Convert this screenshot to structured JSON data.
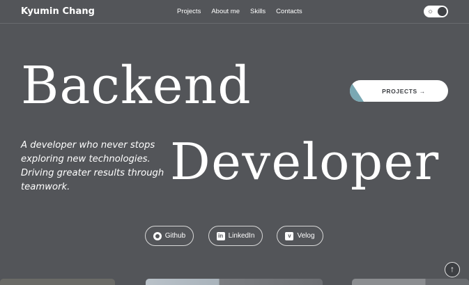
{
  "header": {
    "brand": "Kyumin Chang",
    "nav": [
      "Projects",
      "About me",
      "Skills",
      "Contacts"
    ],
    "theme_toggle": {
      "icon": "sun-icon",
      "state": "dark"
    }
  },
  "hero": {
    "title_line1": "Backend",
    "title_line2": "Developer",
    "tagline": [
      "A developer who never stops",
      "exploring new technologies.",
      "Driving greater results through",
      "teamwork."
    ],
    "projects_button": "PROJECTS →"
  },
  "social": {
    "github": "Github",
    "linkedin": "LinkedIn",
    "velog": "Velog"
  },
  "scroll_top_icon": "arrow-up-icon",
  "colors": {
    "background": "#535559",
    "text": "#ffffff",
    "accent": "#7aa8b3"
  }
}
